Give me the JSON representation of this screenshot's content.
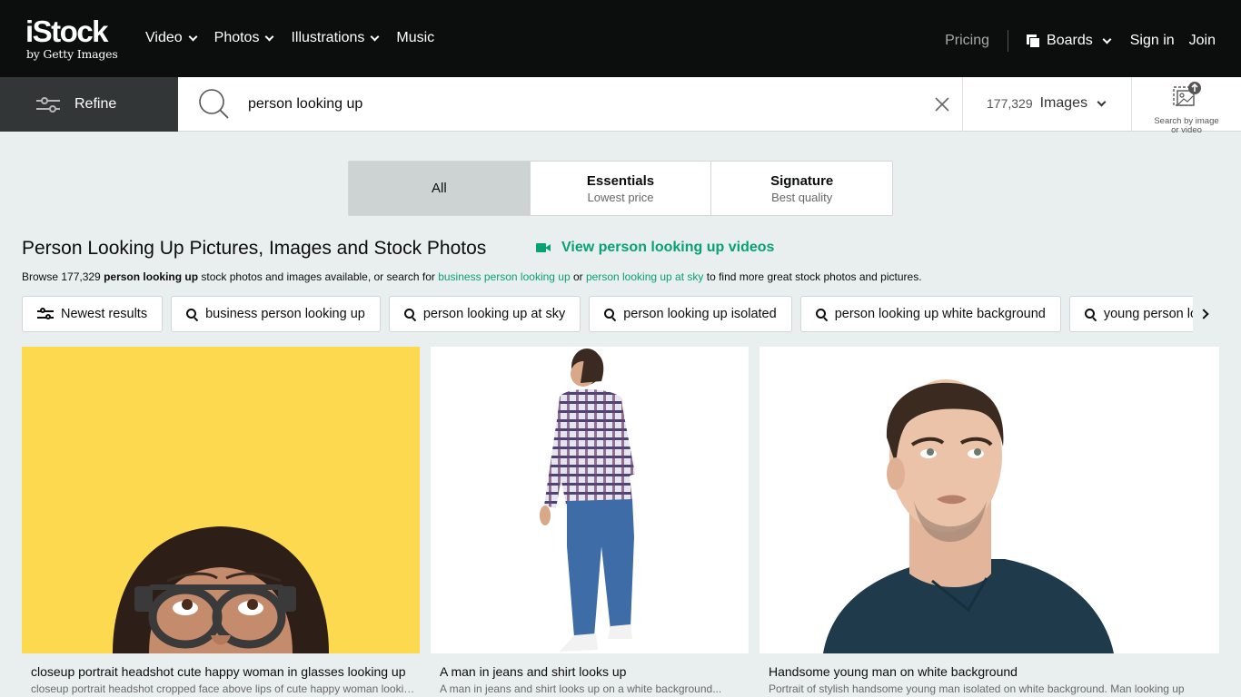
{
  "header": {
    "logo_main": "iStock",
    "logo_sub": "by Getty Images",
    "nav": [
      {
        "label": "Video",
        "has_dropdown": true
      },
      {
        "label": "Photos",
        "has_dropdown": true
      },
      {
        "label": "Illustrations",
        "has_dropdown": true
      },
      {
        "label": "Music",
        "has_dropdown": false
      }
    ],
    "pricing": "Pricing",
    "boards": "Boards",
    "sign_in": "Sign in",
    "join": "Join"
  },
  "search": {
    "refine_label": "Refine",
    "query": "person looking up",
    "result_count": "177,329",
    "asset_type": "Images",
    "image_search_label_line1": "Search by image",
    "image_search_label_line2": "or video"
  },
  "tabs": [
    {
      "title": "All",
      "subtitle": "",
      "active": true
    },
    {
      "title": "Essentials",
      "subtitle": "Lowest price",
      "active": false
    },
    {
      "title": "Signature",
      "subtitle": "Best quality",
      "active": false
    }
  ],
  "heading": {
    "title": "Person Looking Up Pictures, Images and Stock Photos",
    "video_link": "View person looking up videos",
    "browse_prefix": "Browse 177,329 ",
    "browse_term": "person looking up",
    "browse_mid": " stock photos and images available, or search for ",
    "browse_link1": "business person looking up",
    "browse_or": " or ",
    "browse_link2": "person looking up at sky",
    "browse_suffix": " to find more great stock photos and pictures."
  },
  "chips": [
    {
      "label": "Newest results",
      "icon": "sliders-icon"
    },
    {
      "label": "business person looking up",
      "icon": "search-icon"
    },
    {
      "label": "person looking up at sky",
      "icon": "search-icon"
    },
    {
      "label": "person looking up isolated",
      "icon": "search-icon"
    },
    {
      "label": "person looking up white background",
      "icon": "search-icon"
    },
    {
      "label": "young person looking up",
      "icon": "search-icon"
    }
  ],
  "results": [
    {
      "title": "closeup portrait headshot cute happy woman in glasses looking up",
      "description": "closeup portrait headshot cropped face above lips of cute happy woman looking up"
    },
    {
      "title": "A man in jeans and shirt looks up",
      "description": "A man in jeans and shirt looks up on a white background..."
    },
    {
      "title": "Handsome young man on white background",
      "description": "Portrait of stylish handsome young man isolated on white background. Man looking up"
    }
  ],
  "colors": {
    "accent": "#08a175",
    "topbar": "#0c0d0d",
    "refine_bg": "#333637",
    "page_bg": "#e9eeee",
    "tab_active": "#cdd3d3",
    "photo1_bg": "#fcd94f"
  }
}
